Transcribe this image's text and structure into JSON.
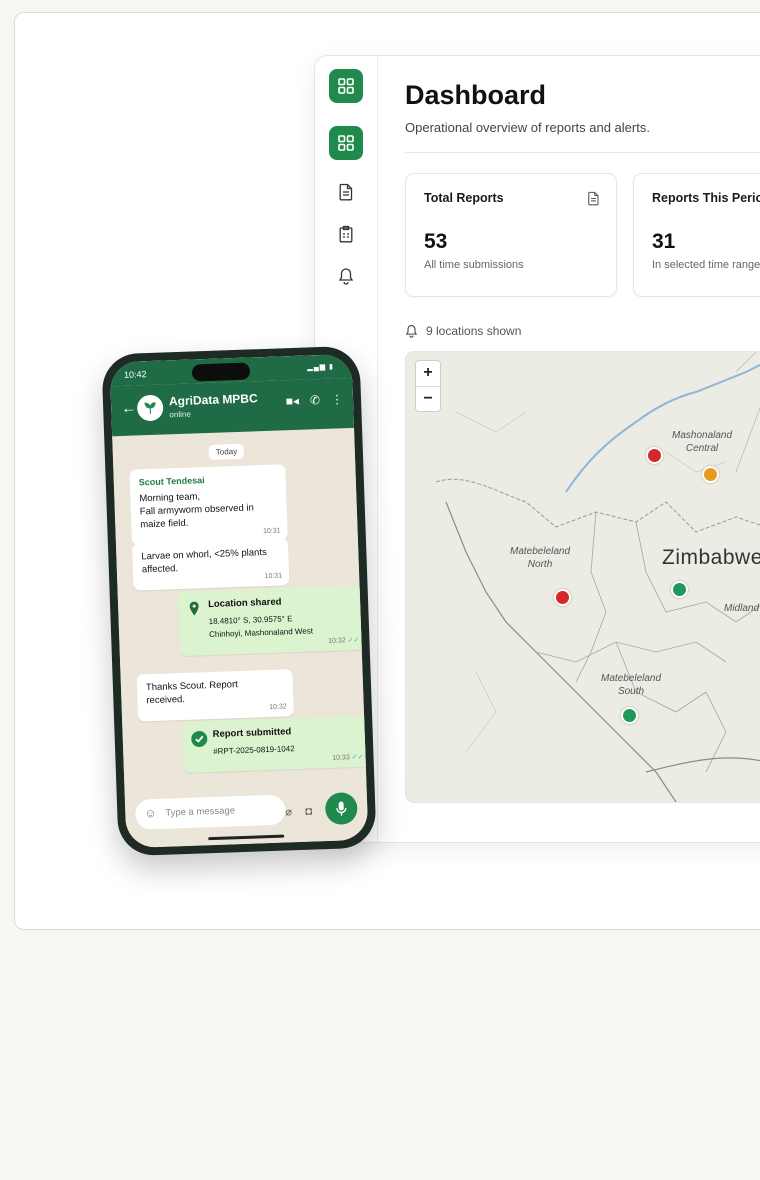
{
  "dashboard": {
    "title": "Dashboard",
    "subtitle": "Operational overview of reports and alerts.",
    "stats": [
      {
        "label": "Total Reports",
        "value": "53",
        "note": "All time submissions"
      },
      {
        "label": "Reports This Period",
        "value": "31",
        "note": "In selected time range"
      }
    ],
    "locations_text": "9 locations shown",
    "map": {
      "zoom_in": "+",
      "zoom_out": "−",
      "country": "Zimbabwe",
      "regions": {
        "mashonaland_central": [
          "Mashonaland",
          "Central"
        ],
        "matebeleland_north": [
          "Matebeleland",
          "North"
        ],
        "matebeleland_south": [
          "Matebeleland",
          "South"
        ],
        "midlands": "Midland"
      },
      "markers": [
        {
          "status": "red"
        },
        {
          "status": "orange"
        },
        {
          "status": "red"
        },
        {
          "status": "green"
        },
        {
          "status": "green"
        }
      ]
    }
  },
  "phone": {
    "time": "10:42",
    "contact_name": "AgriData MPBC",
    "contact_status": "online",
    "day_label": "Today",
    "messages": [
      {
        "sender": "Scout Tendesai",
        "line1": "Morning team,",
        "line2": "Fall armyworm observed in",
        "line3": "maize field.",
        "time": "10:31"
      },
      {
        "line1": "Larvae on whorl, <25% plants",
        "line2": "affected.",
        "time": "10:31"
      },
      {
        "title": "Location shared",
        "line1": "18.4810° S, 30.9575° E",
        "line2": "Chinhoyi, Mashonaland West",
        "time": "10:32"
      },
      {
        "line1": "Thanks Scout. Report",
        "line2": "received.",
        "time": "10:32"
      },
      {
        "title": "Report submitted",
        "line1": "#RPT-2025-0819-1042",
        "time": "10:33"
      }
    ],
    "input_placeholder": "Type a message"
  },
  "colors": {
    "brand_green": "#1f8a4c",
    "header_green": "#1f6b45",
    "marker_red": "#d62828",
    "marker_orange": "#e59b1d",
    "marker_green": "#1f9a5c"
  }
}
